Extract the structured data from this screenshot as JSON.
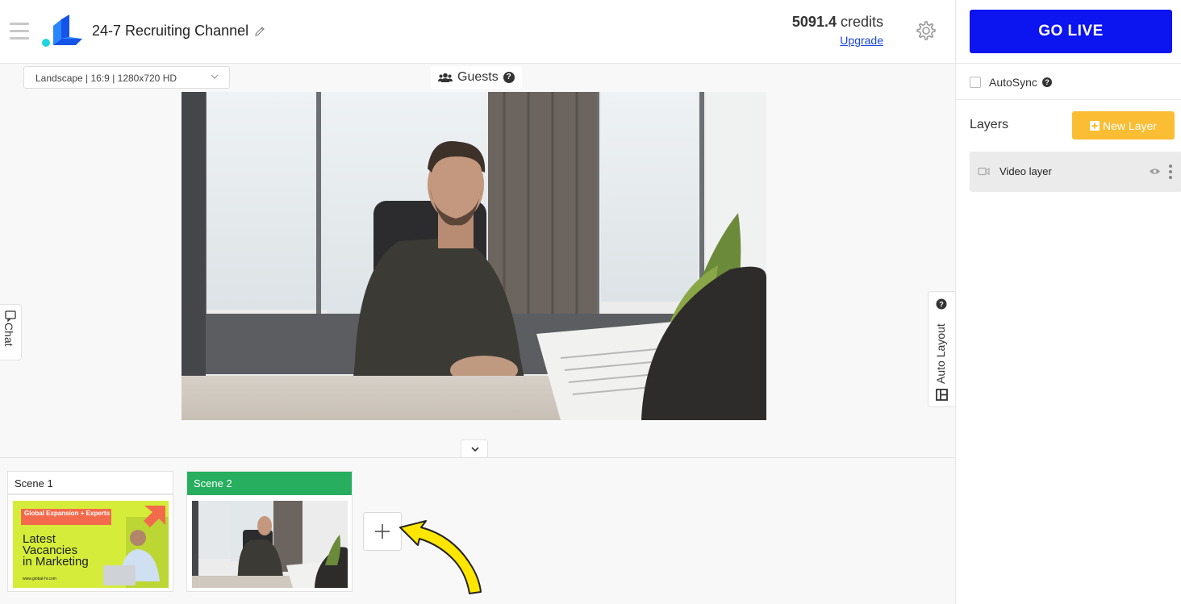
{
  "header": {
    "channel_title": "24-7 Recruiting Channel",
    "credits_value": "5091.4",
    "credits_unit": "credits",
    "upgrade_label": "Upgrade",
    "go_live_label": "GO LIVE"
  },
  "stage": {
    "resolution_select": "Landscape | 16:9 | 1280x720 HD",
    "guests_label": "Guests",
    "guests_help": "?",
    "chat_label": "Chat",
    "auto_layout_label": "Auto Layout"
  },
  "scenes": [
    {
      "label": "Scene 1",
      "active": false,
      "thumb": {
        "badge": "Global Expansion + Experts",
        "headline_line1": "Latest",
        "headline_line2": "Vacancies",
        "headline_line3": "in Marketing",
        "footer": "www.global-hr.com"
      }
    },
    {
      "label": "Scene 2",
      "active": true
    }
  ],
  "right_panel": {
    "autosync_label": "AutoSync",
    "autosync_checked": false,
    "layers_title": "Layers",
    "new_layer_label": "New Layer",
    "layers": [
      {
        "name": "Video layer",
        "visible": true
      }
    ]
  },
  "colors": {
    "go_live": "#0c14f0",
    "new_layer": "#fbbd33",
    "active_scene": "#27ae5f",
    "arrow": "#ffe600"
  },
  "icons": [
    "hamburger-icon",
    "app-logo",
    "pencil-icon",
    "gear-icon",
    "chevron-down-icon",
    "users-icon",
    "help-icon",
    "chat-icon",
    "auto-layout-icon",
    "plus-icon",
    "video-camera-icon",
    "eye-icon",
    "kebab-menu-icon",
    "pointing-arrow"
  ]
}
